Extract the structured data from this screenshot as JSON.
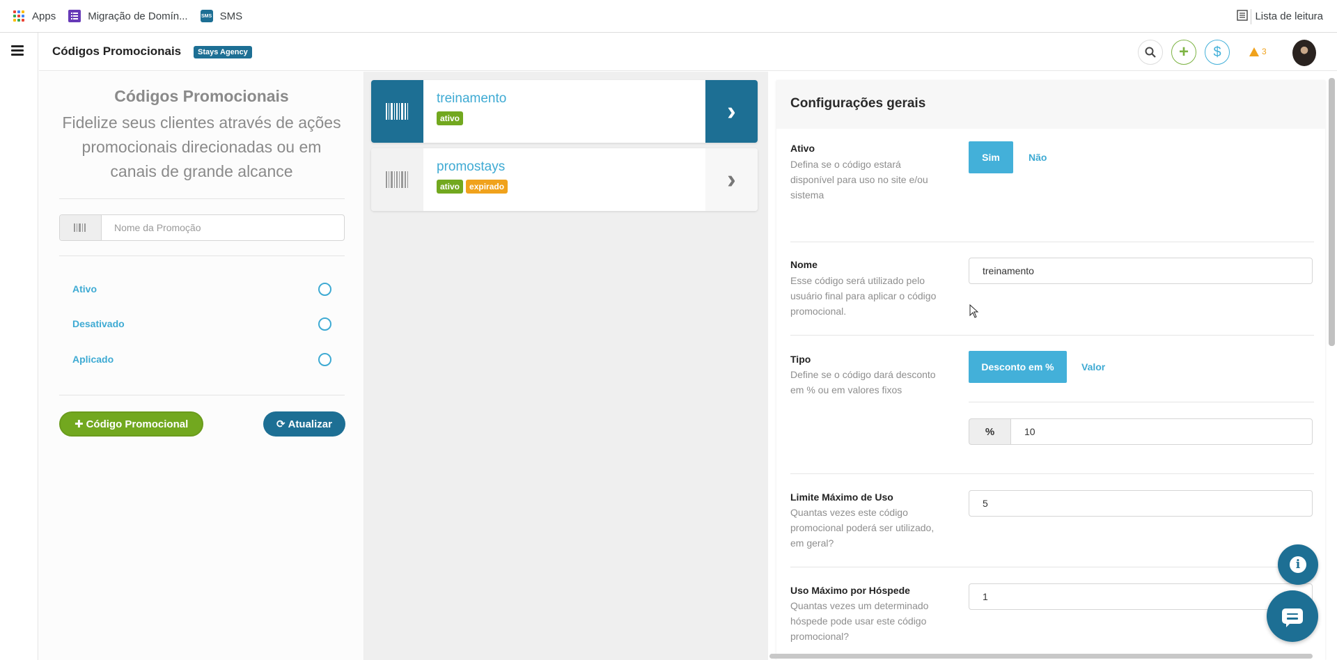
{
  "bookmarks": {
    "apps": "Apps",
    "migracao": "Migração de Domín...",
    "sms": "SMS",
    "sms_icon_text": "SMS",
    "reading_list": "Lista de leitura"
  },
  "header": {
    "title": "Códigos Promocionais",
    "agency": "Stays Agency",
    "warning_count": "3"
  },
  "filters": {
    "title": "Códigos Promocionais",
    "subtitle": "Fidelize seus clientes através de ações promocionais direcionadas ou em canais de grande alcance",
    "search_placeholder": "Nome da Promoção",
    "statuses": [
      "Ativo",
      "Desativado",
      "Aplicado"
    ],
    "add_button": "Código Promocional",
    "refresh_button": "Atualizar"
  },
  "codes": [
    {
      "name": "treinamento",
      "badges": [
        "ativo"
      ],
      "selected": true
    },
    {
      "name": "promostays",
      "badges": [
        "ativo",
        "expirado"
      ],
      "selected": false
    }
  ],
  "config": {
    "title": "Configurações gerais",
    "ativo": {
      "label": "Ativo",
      "desc": "Defina se o código estará disponível para uso no site e/ou sistema",
      "yes": "Sim",
      "no": "Não"
    },
    "nome": {
      "label": "Nome",
      "desc": "Esse código será utilizado pelo usuário final para aplicar o código promocional.",
      "value": "treinamento"
    },
    "tipo": {
      "label": "Tipo",
      "desc": "Define se o código dará desconto em % ou em valores fixos",
      "percent_button": "Desconto em %",
      "value_button": "Valor",
      "addon": "%",
      "amount": "10"
    },
    "limite": {
      "label": "Limite Máximo de Uso",
      "desc": "Quantas vezes este código promocional poderá ser utilizado, em geral?",
      "value": "5"
    },
    "uso_hospede": {
      "label": "Uso Máximo por Hóspede",
      "desc": "Quantas vezes um determinado hóspede pode usar este código promocional?",
      "value": "1"
    }
  },
  "colors": {
    "primary": "#1d6f94",
    "accent": "#43b0d9",
    "success": "#72a81f",
    "warning": "#f0a21c"
  },
  "icons": [
    "apps-grid-icon",
    "bookmark-list-icon",
    "sms-icon",
    "reading-list-icon",
    "menu-icon",
    "search-icon",
    "plus-icon",
    "dollar-icon",
    "warning-icon",
    "barcode-icon",
    "chevron-right-icon",
    "refresh-icon",
    "info-icon",
    "chat-icon",
    "cursor-icon"
  ]
}
